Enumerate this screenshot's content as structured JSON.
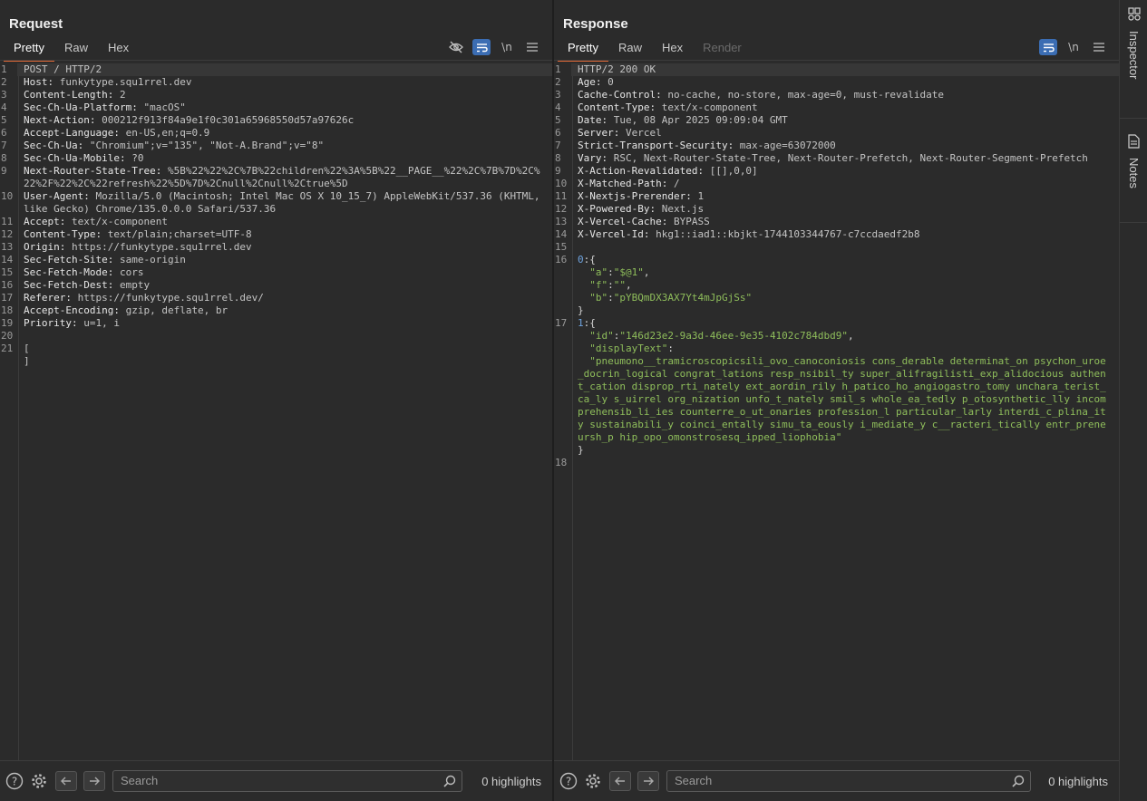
{
  "request": {
    "title": "Request",
    "tabs": [
      "Pretty",
      "Raw",
      "Hex"
    ],
    "active_tab": "Pretty",
    "tools": {
      "wrap_icon": "\\n"
    },
    "lines": [
      {
        "n": "1",
        "k": "",
        "v": "POST / HTTP/2"
      },
      {
        "n": "2",
        "k": "Host:",
        "v": " funkytype.squ1rrel.dev"
      },
      {
        "n": "3",
        "k": "Content-Length:",
        "v": " 2"
      },
      {
        "n": "4",
        "k": "Sec-Ch-Ua-Platform:",
        "v": " \"macOS\""
      },
      {
        "n": "5",
        "k": "Next-Action:",
        "v": " 000212f913f84a9e1f0c301a65968550d57a97626c"
      },
      {
        "n": "6",
        "k": "Accept-Language:",
        "v": " en-US,en;q=0.9"
      },
      {
        "n": "7",
        "k": "Sec-Ch-Ua:",
        "v": " \"Chromium\";v=\"135\", \"Not-A.Brand\";v=\"8\""
      },
      {
        "n": "8",
        "k": "Sec-Ch-Ua-Mobile:",
        "v": " ?0"
      },
      {
        "n": "9",
        "k": "Next-Router-State-Tree:",
        "v": " %5B%22%22%2C%7B%22children%22%3A%5B%22__PAGE__%22%2C%7B%7D%2C%22%2F%22%2C%22refresh%22%5D%7D%2Cnull%2Cnull%2Ctrue%5D"
      },
      {
        "n": "10",
        "k": "User-Agent:",
        "v": " Mozilla/5.0 (Macintosh; Intel Mac OS X 10_15_7) AppleWebKit/537.36 (KHTML, like Gecko) Chrome/135.0.0.0 Safari/537.36"
      },
      {
        "n": "11",
        "k": "Accept:",
        "v": " text/x-component"
      },
      {
        "n": "12",
        "k": "Content-Type:",
        "v": " text/plain;charset=UTF-8"
      },
      {
        "n": "13",
        "k": "Origin:",
        "v": " https://funkytype.squ1rrel.dev"
      },
      {
        "n": "14",
        "k": "Sec-Fetch-Site:",
        "v": " same-origin"
      },
      {
        "n": "15",
        "k": "Sec-Fetch-Mode:",
        "v": " cors"
      },
      {
        "n": "16",
        "k": "Sec-Fetch-Dest:",
        "v": " empty"
      },
      {
        "n": "17",
        "k": "Referer:",
        "v": " https://funkytype.squ1rrel.dev/"
      },
      {
        "n": "18",
        "k": "Accept-Encoding:",
        "v": " gzip, deflate, br"
      },
      {
        "n": "19",
        "k": "Priority:",
        "v": " u=1, i"
      },
      {
        "n": "20",
        "k": "",
        "v": ""
      },
      {
        "n": "21",
        "k": "",
        "v": "[\n]"
      }
    ],
    "search": {
      "placeholder": "Search",
      "highlights": "0 highlights"
    }
  },
  "response": {
    "title": "Response",
    "tabs": [
      "Pretty",
      "Raw",
      "Hex",
      "Render"
    ],
    "active_tab": "Pretty",
    "tools": {
      "wrap_icon": "\\n"
    },
    "lines": [
      {
        "n": "1",
        "k": "",
        "v": "HTTP/2 200 OK"
      },
      {
        "n": "2",
        "k": "Age:",
        "v": " 0"
      },
      {
        "n": "3",
        "k": "Cache-Control:",
        "v": " no-cache, no-store, max-age=0, must-revalidate"
      },
      {
        "n": "4",
        "k": "Content-Type:",
        "v": " text/x-component"
      },
      {
        "n": "5",
        "k": "Date:",
        "v": " Tue, 08 Apr 2025 09:09:04 GMT"
      },
      {
        "n": "6",
        "k": "Server:",
        "v": " Vercel"
      },
      {
        "n": "7",
        "k": "Strict-Transport-Security:",
        "v": " max-age=63072000"
      },
      {
        "n": "8",
        "k": "Vary:",
        "v": " RSC, Next-Router-State-Tree, Next-Router-Prefetch, Next-Router-Segment-Prefetch"
      },
      {
        "n": "9",
        "k": "X-Action-Revalidated:",
        "v": " [[],0,0]"
      },
      {
        "n": "10",
        "k": "X-Matched-Path:",
        "v": " /"
      },
      {
        "n": "11",
        "k": "X-Nextjs-Prerender:",
        "v": " 1"
      },
      {
        "n": "12",
        "k": "X-Powered-By:",
        "v": " Next.js"
      },
      {
        "n": "13",
        "k": "X-Vercel-Cache:",
        "v": " BYPASS"
      },
      {
        "n": "14",
        "k": "X-Vercel-Id:",
        "v": " hkg1::iad1::kbjkt-1744103344767-c7ccdaedf2b8"
      },
      {
        "n": "15",
        "k": "",
        "v": ""
      }
    ],
    "body": {
      "block0": {
        "n": "16",
        "prefix": "0",
        "a_key": "\"a\"",
        "a_val": "\"$@1\"",
        "f_key": "\"f\"",
        "f_val": "\"\"",
        "b_key": "\"b\"",
        "b_val": "\"pYBQmDX3AX7Yt4mJpGjSs\""
      },
      "block1": {
        "n": "17",
        "prefix": "1",
        "id_key": "\"id\"",
        "id_val": "\"146d23e2-9a3d-46ee-9e35-4102c784dbd9\"",
        "dt_key": "\"displayText\"",
        "dt_val": "\"pneumono__tramicroscopicsili_ovo_canoconiosis cons_derable determinat_on psychon_uroe_docrin_logical congrat_lations resp_nsibil_ty super_alifragilisti_exp_alidocious authent_cation disprop_rti_nately ext_aordin_rily h_patico_ho_angiogastro_tomy unchara_terist_ca_ly s_uirrel org_nization unfo_t_nately smil_s whole_ea_tedly p_otosynthetic_lly incomprehensib_li_ies counterre_o_ut_onaries profession_l particular_larly interdi_c_plina_ity sustainabili_y coinci_entally simu_ta_eously i_mediate_y c__racteri_tically entr_preneursh_p hip_opo_omonstrosesq_ipped_liophobia\""
      },
      "last_line": "18"
    },
    "search": {
      "placeholder": "Search",
      "highlights": "0 highlights"
    }
  },
  "sidebar": {
    "inspector": "Inspector",
    "notes": "Notes"
  },
  "colors": {
    "accent_tab": "#e46a37",
    "toggle_on": "#3b6db3",
    "string": "#8fbe5b",
    "key_number": "#6fa4e0"
  }
}
